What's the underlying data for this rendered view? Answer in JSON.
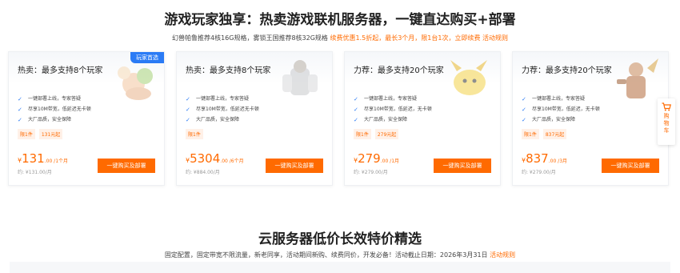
{
  "section1": {
    "title": "游戏玩家独享：热卖游戏联机服务器，一键直达购买+部署",
    "subtitle_plain": "幻兽帕鲁推荐4核16G规格，雾锁王国推荐8核32G规格 ",
    "subtitle_promo": "续费优惠1.5折起，最长3个月，限1台1次，立即续费 活动规则"
  },
  "cards": [
    {
      "title": "热卖：最多支持8个玩家",
      "badge": "玩家首选",
      "features": [
        "一键部署上线，专家答疑",
        "尽享10M带宽，低延迟无卡顿",
        "大厂品质，安全保障"
      ],
      "tags": [
        "限1件",
        "131元起"
      ],
      "currency": "¥",
      "price": "131",
      "unit": ".00 /1个月",
      "original": "约: ¥131.00/月",
      "button": "一键购买及部署",
      "deco_icon": "fruit-character-icon"
    },
    {
      "title": "热卖：最多支持8个玩家",
      "features": [
        "一键部署上线，专家答疑",
        "尽享10M带宽，低延迟无卡顿",
        "大厂品质，安全保障"
      ],
      "tags": [
        "限1件"
      ],
      "currency": "¥",
      "price": "5304",
      "unit": ".00 /6个月",
      "original": "约: ¥884.00/月",
      "button": "一键购买及部署",
      "deco_icon": "armored-character-icon"
    },
    {
      "title": "力荐：最多支持20个玩家",
      "features": [
        "一键部署上线，专家答疑",
        "尽享10M带宽，低延迟，无卡顿",
        "大厂品质，安全保障"
      ],
      "tags": [
        "限1件",
        "279元起"
      ],
      "currency": "¥",
      "price": "279",
      "unit": ".00 /1月",
      "original": "约: ¥279.00/月",
      "button": "一键购买及部署",
      "deco_icon": "yellow-creature-icon"
    },
    {
      "title": "力荐：最多支持20个玩家",
      "features": [
        "一键部署上线，专家答疑",
        "尽享10M带宽，低延迟，无卡顿",
        "大厂品质，安全保障"
      ],
      "tags": [
        "限1件",
        "837元起"
      ],
      "currency": "¥",
      "price": "837",
      "unit": ".00 /3月",
      "original": "约: ¥279.00/月",
      "button": "一键购买及部署",
      "deco_icon": "warrior-character-icon"
    }
  ],
  "cart": {
    "label": "购物车",
    "icon": "shopping-cart-icon"
  },
  "section2": {
    "title": "云服务器低价长效特价精选",
    "subtitle_plain": "固定配置，固定带宽不限流量，新老同享，活动期间新购、续费同价，开发必备！活动截止日期：2026年3月31日 ",
    "subtitle_promo": "活动规则"
  },
  "colors": {
    "accent": "#ff6a00",
    "badge": "#2b7bf5",
    "check": "#2b7bf5"
  }
}
